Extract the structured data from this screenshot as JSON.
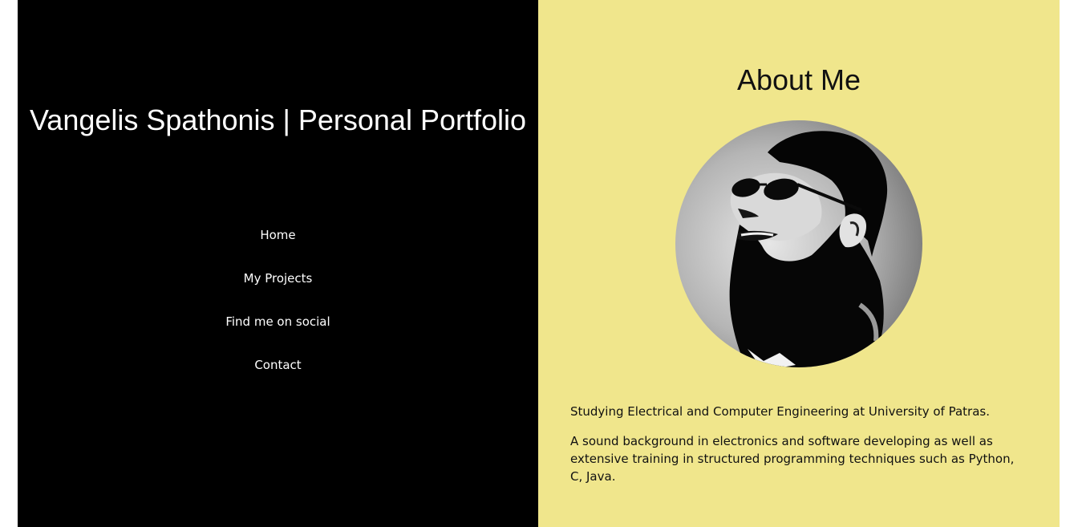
{
  "colors": {
    "left_panel_bg": "#000000",
    "right_panel_bg": "#f0e68c",
    "text_light": "#ffffff",
    "text_dark": "#111111"
  },
  "header": {
    "title": "Vangelis Spathonis | Personal Portfolio"
  },
  "nav": {
    "items": [
      {
        "label": "Home"
      },
      {
        "label": "My Projects"
      },
      {
        "label": "Find me on social"
      },
      {
        "label": "Contact"
      }
    ]
  },
  "about": {
    "title": "About Me",
    "photo_alt": "profile-photo",
    "paragraphs": [
      "Studying Electrical and Computer Engineering at University of Patras.",
      "A sound background in electronics and software developing as well as extensive training in structured programming techniques such as Python, C, Java."
    ]
  }
}
